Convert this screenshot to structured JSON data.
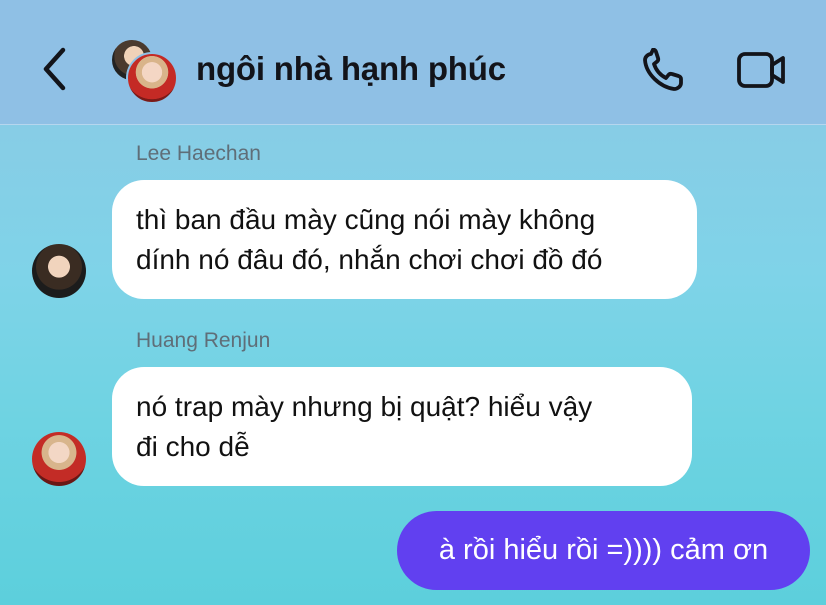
{
  "header": {
    "title": "ngôi nhà hạnh phúc",
    "back_icon": "chevron-left-icon",
    "call_icon": "phone-icon",
    "video_icon": "video-camera-icon"
  },
  "messages": [
    {
      "sender": "Lee Haechan",
      "lines": [
        "thì ban đầu mày cũng nói mày không",
        "dính nó đâu đó, nhắn chơi chơi đồ đó"
      ]
    },
    {
      "sender": "Huang Renjun",
      "lines": [
        "nó trap mày nhưng bị quật? hiểu vậy",
        "đi cho dễ"
      ]
    }
  ],
  "own_message": "à rồi hiểu rồi =)))) cảm ơn",
  "colors": {
    "header_bg": "#8fc0e5",
    "own_bubble": "#6140f0",
    "incoming_bubble": "#ffffff",
    "icon": "#13141a"
  }
}
